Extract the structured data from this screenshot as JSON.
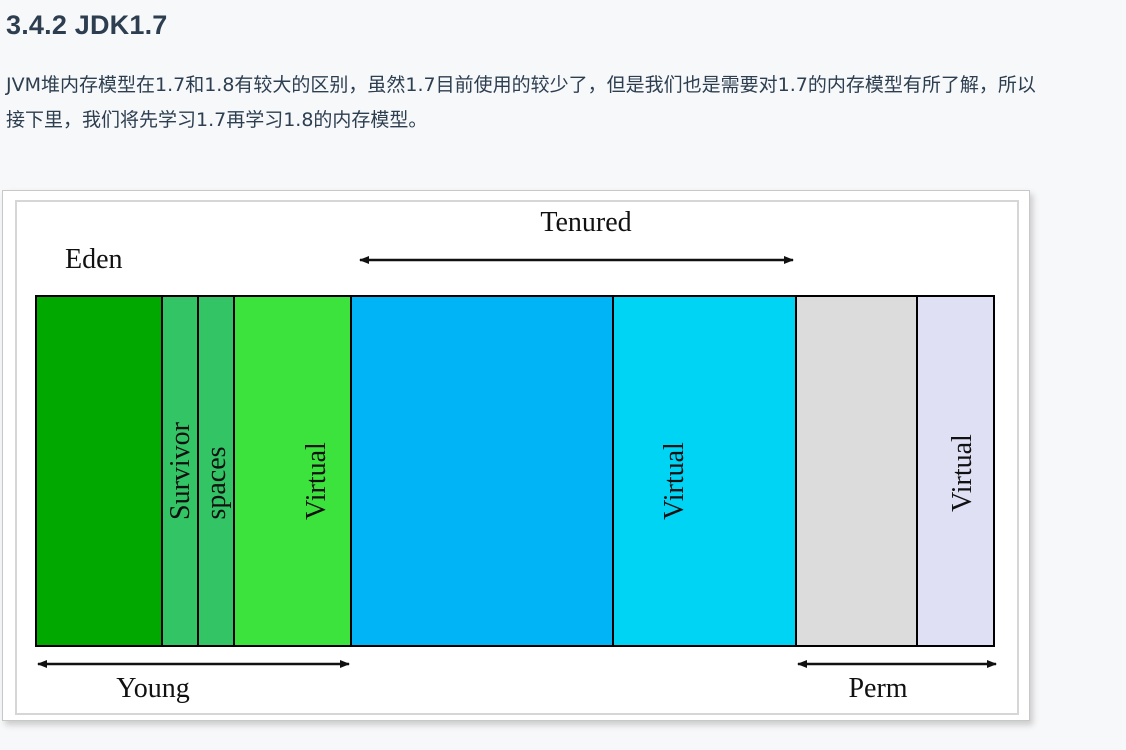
{
  "heading": "3.4.2 JDK1.7",
  "paragraph": "JVM堆内存模型在1.7和1.8有较大的区别，虽然1.7目前使用的较少了，但是我们也是需要对1.7的内存模型有所了解，所以接下里，我们将先学习1.7再学习1.8的内存模型。",
  "diagram": {
    "labels": {
      "eden": "Eden",
      "tenured": "Tenured",
      "young": "Young",
      "perm": "Perm"
    },
    "segments": [
      {
        "key": "eden",
        "text": "",
        "color": "#00a800"
      },
      {
        "key": "survivor-1",
        "text": "Survivor",
        "color": "#33c466"
      },
      {
        "key": "survivor-2",
        "text": "spaces",
        "color": "#33c466"
      },
      {
        "key": "young-virtual",
        "text": "Virtual",
        "color": "#3de33d"
      },
      {
        "key": "tenured",
        "text": "",
        "color": "#00b4f6"
      },
      {
        "key": "tenured-virtual",
        "text": "Virtual",
        "color": "#00d4f5"
      },
      {
        "key": "perm",
        "text": "",
        "color": "#dcdcdc"
      },
      {
        "key": "perm-virtual",
        "text": "Virtual",
        "color": "#e0e0f5"
      }
    ]
  }
}
